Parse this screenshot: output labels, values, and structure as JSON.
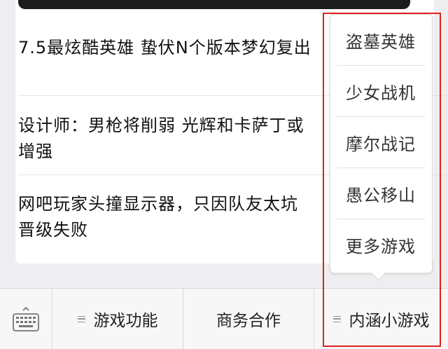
{
  "articles": [
    {
      "title": "7.5最炫酷英雄 蛰伏N个版本梦幻复出"
    },
    {
      "title": "设计师：男枪将削弱 光辉和卡萨丁或增强"
    },
    {
      "title": "网吧玩家头撞显示器，只因队友太坑 晋级失败"
    }
  ],
  "bottom_menu": {
    "keyboard_icon": "keyboard-icon",
    "tabs": [
      {
        "label": "游戏功能",
        "has_submenu": true
      },
      {
        "label": "商务合作",
        "has_submenu": false
      },
      {
        "label": "内涵小游戏",
        "has_submenu": true
      }
    ]
  },
  "submenu": {
    "items": [
      {
        "label": "盗墓英雄"
      },
      {
        "label": "少女战机"
      },
      {
        "label": "摩尔战记"
      },
      {
        "label": "愚公移山"
      },
      {
        "label": "更多游戏"
      }
    ]
  },
  "colors": {
    "highlight": "#e02020",
    "background": "#eeeef0"
  }
}
